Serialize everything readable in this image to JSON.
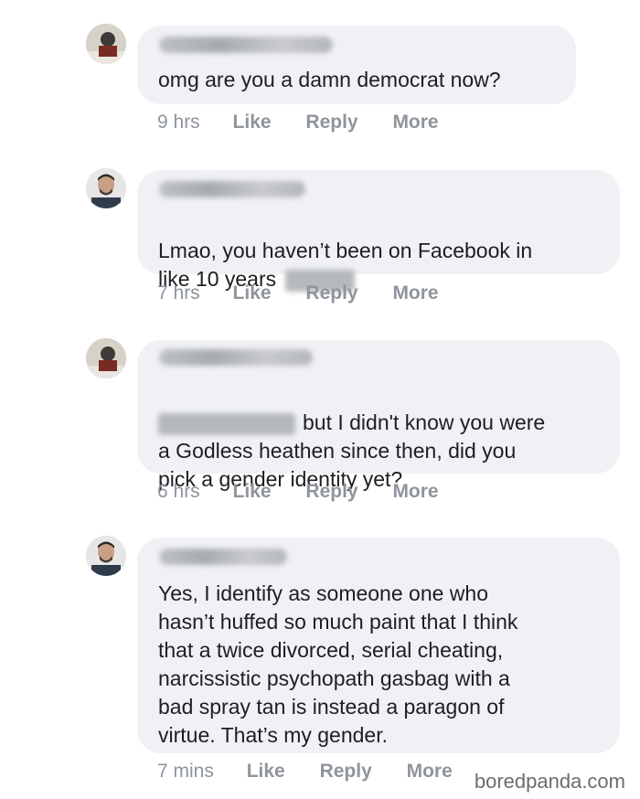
{
  "comments": [
    {
      "text": "omg are you a damn democrat now?",
      "time": "9 hrs",
      "like": "Like",
      "reply": "Reply",
      "more": "More"
    },
    {
      "text": "Lmao, you haven’t been on Facebook in\nlike 10 years",
      "time": "7 hrs",
      "like": "Like",
      "reply": "Reply",
      "more": "More"
    },
    {
      "text_line1": "but I didn't know you were",
      "text_rest": "a Godless heathen since then, did you\npick a gender identity yet?",
      "time": "6 hrs",
      "like": "Like",
      "reply": "Reply",
      "more": "More"
    },
    {
      "text": "Yes, I identify as someone one who\nhasn’t huffed so much paint that I think\nthat a twice divorced, serial cheating,\nnarcissistic psychopath gasbag with a\nbad spray tan is instead a paragon of\nvirtue. That’s my gender.",
      "time": "7 mins",
      "like": "Like",
      "reply": "Reply",
      "more": "More"
    }
  ],
  "watermark": "boredpanda.com"
}
